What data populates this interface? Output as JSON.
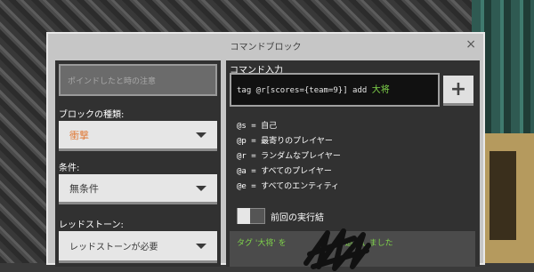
{
  "window": {
    "title": "コマンドブロック",
    "close_symbol": "×"
  },
  "left": {
    "hover_note_placeholder": "ポインドしたと時の注意",
    "block_type_label": "ブロックの種類:",
    "block_type_value": "衝撃",
    "condition_label": "条件:",
    "condition_value": "無条件",
    "redstone_label": "レッドストーン:",
    "redstone_value": "レッドストーンが必要"
  },
  "right": {
    "command_label": "コマンド入力",
    "command_text": "tag @r[scores={team=9}] add ",
    "command_highlight": "大将",
    "plus_label": "+",
    "help": [
      "@s = 自己",
      "@p = 最寄りのプレイヤー",
      "@r = ランダムなプレイヤー",
      "@a = すべてのプレイヤー",
      "@e = すべてのエンティティ"
    ],
    "previous_output_label": "前回の実行結",
    "output_prefix": "タグ '大将' を",
    "output_suffix": "追加しました"
  }
}
